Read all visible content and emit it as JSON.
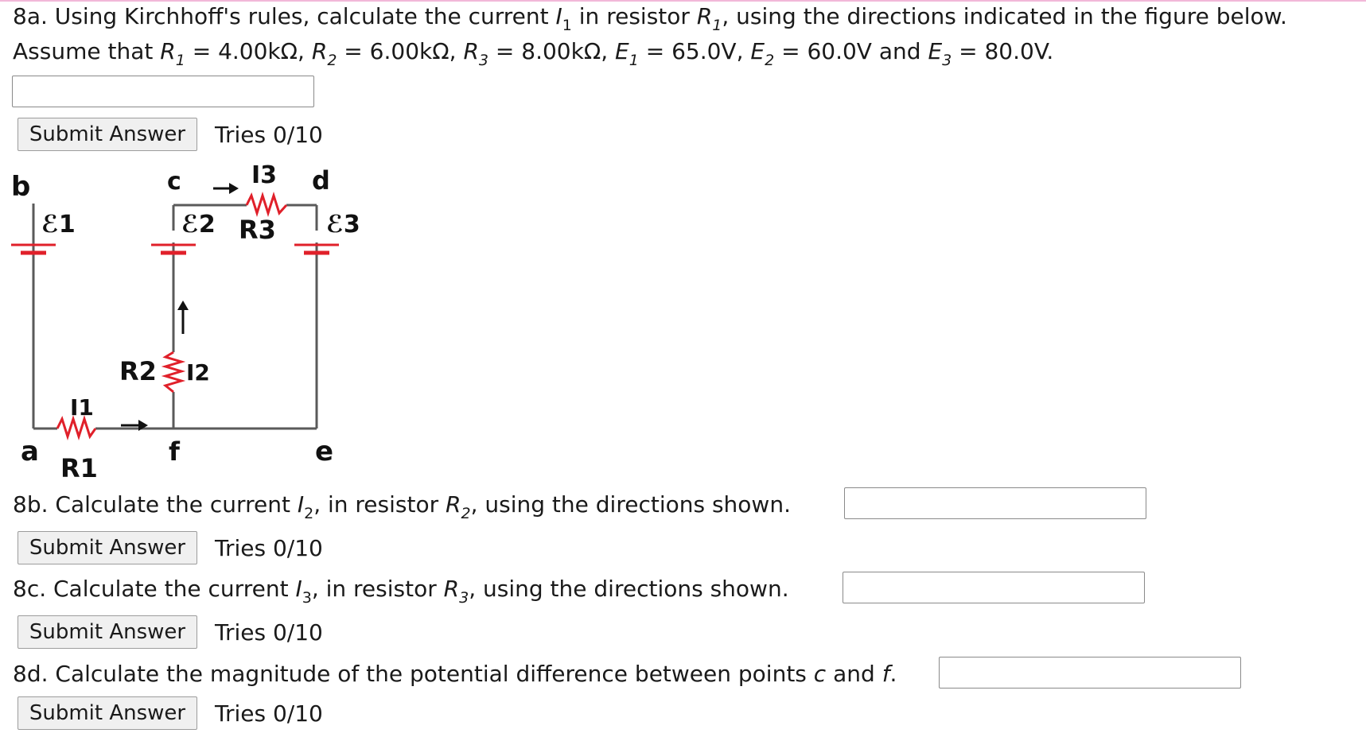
{
  "q8a": {
    "line1_prefix": "8a. Using Kirchhoff's rules, calculate the current ",
    "line1_var": "I",
    "line1_var_sub": "1",
    "line1_mid": " in resistor ",
    "line1_r": "R",
    "line1_r_sub": "1",
    "line1_suffix": ", using the directions indicated in the figure below.",
    "line2_prefix": "Assume that ",
    "line2_text": "R1 = 4.00kΩ, R2 = 6.00kΩ, R3 = 8.00kΩ, E1 = 65.0V, E2 = 60.0V and E3 = 80.0V.",
    "answer_value": "",
    "submit_label": "Submit Answer",
    "tries": "Tries 0/10"
  },
  "q8b": {
    "prefix": "8b. Calculate the current ",
    "var": "I",
    "var_sub": "2",
    "mid": ", in resistor ",
    "r": "R",
    "r_sub": "2",
    "suffix": ", using the directions shown.",
    "answer_value": "",
    "submit_label": "Submit Answer",
    "tries": "Tries 0/10"
  },
  "q8c": {
    "prefix": "8c. Calculate the current ",
    "var": "I",
    "var_sub": "3",
    "mid": ", in resistor ",
    "r": "R",
    "r_sub": "3",
    "suffix": ", using the directions shown.",
    "answer_value": "",
    "submit_label": "Submit Answer",
    "tries": "Tries 0/10"
  },
  "q8d": {
    "prefix": "8d. Calculate the magnitude of the potential difference between points ",
    "p1": "c",
    "and": " and ",
    "p2": "f",
    "end": ".",
    "answer_value": "",
    "submit_label": "Submit Answer",
    "tries": "Tries 0/10"
  },
  "figure": {
    "labels": {
      "b": "b",
      "c": "c",
      "d": "d",
      "a": "a",
      "f": "f",
      "e": "e",
      "emf1": "ℰ1",
      "emf2": "ℰ2",
      "emf3": "ℰ3",
      "R1": "R1",
      "R2": "R2",
      "R3": "R3",
      "I1": "I1",
      "I2": "I2",
      "I3": "I3"
    },
    "colors": {
      "wire": "#5a5a5a",
      "component": "#e0202a",
      "text": "#111111"
    }
  }
}
